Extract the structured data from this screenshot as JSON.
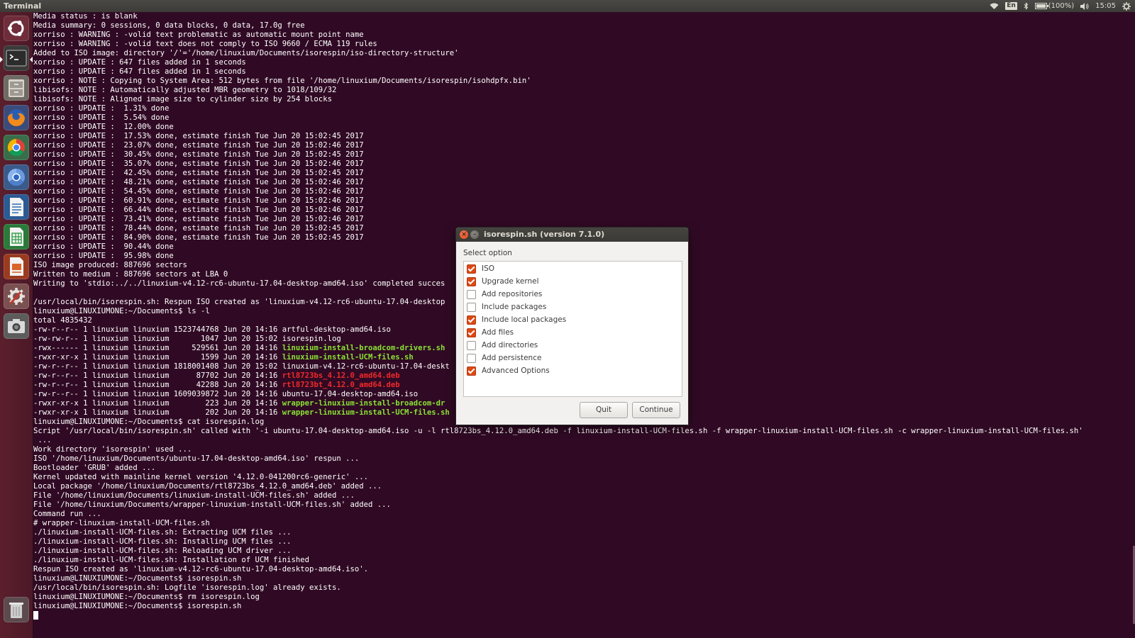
{
  "top_panel": {
    "app_title": "Terminal",
    "keyboard_layout": "En",
    "battery": "(100%)",
    "battery_level": 1.0,
    "clock": "15:05",
    "icons": [
      "wifi-icon",
      "keyboard-indicator",
      "bluetooth-icon",
      "battery-icon",
      "volume-icon",
      "session-gear-icon"
    ]
  },
  "launcher": {
    "items": [
      "ubuntu-dash",
      "terminal",
      "files",
      "firefox",
      "chrome",
      "chromium",
      "libreoffice-writer",
      "libreoffice-calc",
      "libreoffice-impress",
      "system-settings",
      "screenshot",
      "trash"
    ]
  },
  "terminal": {
    "lines": [
      [
        {
          "t": "Media status : is blank"
        }
      ],
      [
        {
          "t": "Media summary: 0 sessions, 0 data blocks, 0 data, 17.0g free"
        }
      ],
      [
        {
          "t": "xorriso : WARNING : -volid text problematic as automatic mount point name"
        }
      ],
      [
        {
          "t": "xorriso : WARNING : -volid text does not comply to ISO 9660 / ECMA 119 rules"
        }
      ],
      [
        {
          "t": "Added to ISO image: directory '/'='/home/linuxium/Documents/isorespin/iso-directory-structure'"
        }
      ],
      [
        {
          "t": "xorriso : UPDATE : 647 files added in 1 seconds"
        }
      ],
      [
        {
          "t": "xorriso : UPDATE : 647 files added in 1 seconds"
        }
      ],
      [
        {
          "t": "xorriso : NOTE : Copying to System Area: 512 bytes from file '/home/linuxium/Documents/isorespin/isohdpfx.bin'"
        }
      ],
      [
        {
          "t": "libisofs: NOTE : Automatically adjusted MBR geometry to 1018/109/32"
        }
      ],
      [
        {
          "t": "libisofs: NOTE : Aligned image size to cylinder size by 254 blocks"
        }
      ],
      [
        {
          "t": "xorriso : UPDATE :  1.31% done"
        }
      ],
      [
        {
          "t": "xorriso : UPDATE :  5.54% done"
        }
      ],
      [
        {
          "t": "xorriso : UPDATE :  12.00% done"
        }
      ],
      [
        {
          "t": "xorriso : UPDATE :  17.53% done, estimate finish Tue Jun 20 15:02:45 2017"
        }
      ],
      [
        {
          "t": "xorriso : UPDATE :  23.07% done, estimate finish Tue Jun 20 15:02:46 2017"
        }
      ],
      [
        {
          "t": "xorriso : UPDATE :  30.45% done, estimate finish Tue Jun 20 15:02:45 2017"
        }
      ],
      [
        {
          "t": "xorriso : UPDATE :  35.07% done, estimate finish Tue Jun 20 15:02:46 2017"
        }
      ],
      [
        {
          "t": "xorriso : UPDATE :  42.45% done, estimate finish Tue Jun 20 15:02:45 2017"
        }
      ],
      [
        {
          "t": "xorriso : UPDATE :  48.21% done, estimate finish Tue Jun 20 15:02:46 2017"
        }
      ],
      [
        {
          "t": "xorriso : UPDATE :  54.45% done, estimate finish Tue Jun 20 15:02:46 2017"
        }
      ],
      [
        {
          "t": "xorriso : UPDATE :  60.91% done, estimate finish Tue Jun 20 15:02:46 2017"
        }
      ],
      [
        {
          "t": "xorriso : UPDATE :  66.44% done, estimate finish Tue Jun 20 15:02:46 2017"
        }
      ],
      [
        {
          "t": "xorriso : UPDATE :  73.41% done, estimate finish Tue Jun 20 15:02:46 2017"
        }
      ],
      [
        {
          "t": "xorriso : UPDATE :  78.44% done, estimate finish Tue Jun 20 15:02:45 2017"
        }
      ],
      [
        {
          "t": "xorriso : UPDATE :  84.90% done, estimate finish Tue Jun 20 15:02:45 2017"
        }
      ],
      [
        {
          "t": "xorriso : UPDATE :  90.44% done"
        }
      ],
      [
        {
          "t": "xorriso : UPDATE :  95.98% done"
        }
      ],
      [
        {
          "t": "ISO image produced: 887696 sectors"
        }
      ],
      [
        {
          "t": "Written to medium : 887696 sectors at LBA 0"
        }
      ],
      [
        {
          "t": "Writing to 'stdio:../../linuxium-v4.12-rc6-ubuntu-17.04-desktop-amd64.iso' completed succes"
        }
      ],
      [
        {
          "t": ""
        }
      ],
      [
        {
          "t": "/usr/local/bin/isorespin.sh: Respun ISO created as 'linuxium-v4.12-rc6-ubuntu-17.04-desktop                                      tails."
        }
      ],
      [
        {
          "t": "linuxium@LINUXIUMONE:~/Documents$ ls -l"
        }
      ],
      [
        {
          "t": "total 4835432"
        }
      ],
      [
        {
          "t": "-rw-r--r-- 1 linuxium linuxium 1523744768 Jun 20 14:16 artful-desktop-amd64.iso"
        }
      ],
      [
        {
          "t": "-rw-rw-r-- 1 linuxium linuxium       1047 Jun 20 15:02 isorespin.log"
        }
      ],
      [
        {
          "t": "-rwx------ 1 linuxium linuxium     529561 Jun 20 14:16 "
        },
        {
          "t": "linuxium-install-broadcom-drivers.sh",
          "c": "g"
        }
      ],
      [
        {
          "t": "-rwxr-xr-x 1 linuxium linuxium       1599 Jun 20 14:16 "
        },
        {
          "t": "linuxium-install-UCM-files.sh",
          "c": "g"
        }
      ],
      [
        {
          "t": "-rw-r--r-- 1 linuxium linuxium 1818001408 Jun 20 15:02 linuxium-v4.12-rc6-ubuntu-17.04-deskt"
        }
      ],
      [
        {
          "t": "-rw-r--r-- 1 linuxium linuxium      87702 Jun 20 14:16 "
        },
        {
          "t": "rtl8723bs_4.12.0_amd64.deb",
          "c": "r"
        }
      ],
      [
        {
          "t": "-rw-r--r-- 1 linuxium linuxium      42288 Jun 20 14:16 "
        },
        {
          "t": "rtl8723bt_4.12.0_amd64.deb",
          "c": "r"
        }
      ],
      [
        {
          "t": "-rw-r--r-- 1 linuxium linuxium 1609039872 Jun 20 14:16 ubuntu-17.04-desktop-amd64.iso"
        }
      ],
      [
        {
          "t": "-rwxr-xr-x 1 linuxium linuxium        223 Jun 20 14:16 "
        },
        {
          "t": "wrapper-linuxium-install-broadcom-dr",
          "c": "g"
        }
      ],
      [
        {
          "t": "-rwxr-xr-x 1 linuxium linuxium        202 Jun 20 14:16 "
        },
        {
          "t": "wrapper-linuxium-install-UCM-files.sh",
          "c": "g"
        }
      ],
      [
        {
          "t": "linuxium@LINUXIUMONE:~/Documents$ cat isorespin.log"
        }
      ],
      [
        {
          "t": "Script '/usr/local/bin/isorespin.sh' called with '-i ubuntu-17.04-desktop-amd64.iso -u -l rtl8723bs_4.12.0_amd64.deb -f linuxium-install-UCM-files.sh -f wrapper-linuxium-install-UCM-files.sh -c wrapper-linuxium-install-UCM-files.sh'"
        }
      ],
      [
        {
          "t": " ..."
        }
      ],
      [
        {
          "t": "Work directory 'isorespin' used ..."
        }
      ],
      [
        {
          "t": "ISO '/home/linuxium/Documents/ubuntu-17.04-desktop-amd64.iso' respun ..."
        }
      ],
      [
        {
          "t": "Bootloader 'GRUB' added ..."
        }
      ],
      [
        {
          "t": "Kernel updated with mainline kernel version '4.12.0-041200rc6-generic' ..."
        }
      ],
      [
        {
          "t": "Local package '/home/linuxium/Documents/rtl8723bs_4.12.0_amd64.deb' added ..."
        }
      ],
      [
        {
          "t": "File '/home/linuxium/Documents/linuxium-install-UCM-files.sh' added ..."
        }
      ],
      [
        {
          "t": "File '/home/linuxium/Documents/wrapper-linuxium-install-UCM-files.sh' added ..."
        }
      ],
      [
        {
          "t": "Command run ..."
        }
      ],
      [
        {
          "t": "# wrapper-linuxium-install-UCM-files.sh"
        }
      ],
      [
        {
          "t": "./linuxium-install-UCM-files.sh: Extracting UCM files ..."
        }
      ],
      [
        {
          "t": "./linuxium-install-UCM-files.sh: Installing UCM files ..."
        }
      ],
      [
        {
          "t": "./linuxium-install-UCM-files.sh: Reloading UCM driver ..."
        }
      ],
      [
        {
          "t": "./linuxium-install-UCM-files.sh: Installation of UCM finished"
        }
      ],
      [
        {
          "t": "Respun ISO created as 'linuxium-v4.12-rc6-ubuntu-17.04-desktop-amd64.iso'."
        }
      ],
      [
        {
          "t": "linuxium@LINUXIUMONE:~/Documents$ isorespin.sh"
        }
      ],
      [
        {
          "t": "/usr/local/bin/isorespin.sh: Logfile 'isorespin.log' already exists."
        }
      ],
      [
        {
          "t": "linuxium@LINUXIUMONE:~/Documents$ rm isorespin.log"
        }
      ],
      [
        {
          "t": "linuxium@LINUXIUMONE:~/Documents$ isorespin.sh"
        }
      ],
      [
        {
          "t": "",
          "cursor": true
        }
      ]
    ]
  },
  "dialog": {
    "title": "isorespin.sh (version 7.1.0)",
    "prompt": "Select option",
    "options": [
      {
        "label": "ISO",
        "checked": true
      },
      {
        "label": "Upgrade kernel",
        "checked": true
      },
      {
        "label": "Add repositories",
        "checked": false
      },
      {
        "label": "Include packages",
        "checked": false
      },
      {
        "label": "Include local packages",
        "checked": true
      },
      {
        "label": "Add files",
        "checked": true
      },
      {
        "label": "Add directories",
        "checked": false
      },
      {
        "label": "Add persistence",
        "checked": false
      },
      {
        "label": "Advanced Options",
        "checked": true
      }
    ],
    "quit_label": "Quit",
    "continue_label": "Continue"
  },
  "colors": {
    "terminal_bg": "#300a24",
    "executable_green": "#8ae234",
    "archive_red": "#ef2929",
    "accent_orange": "#dd4814"
  }
}
